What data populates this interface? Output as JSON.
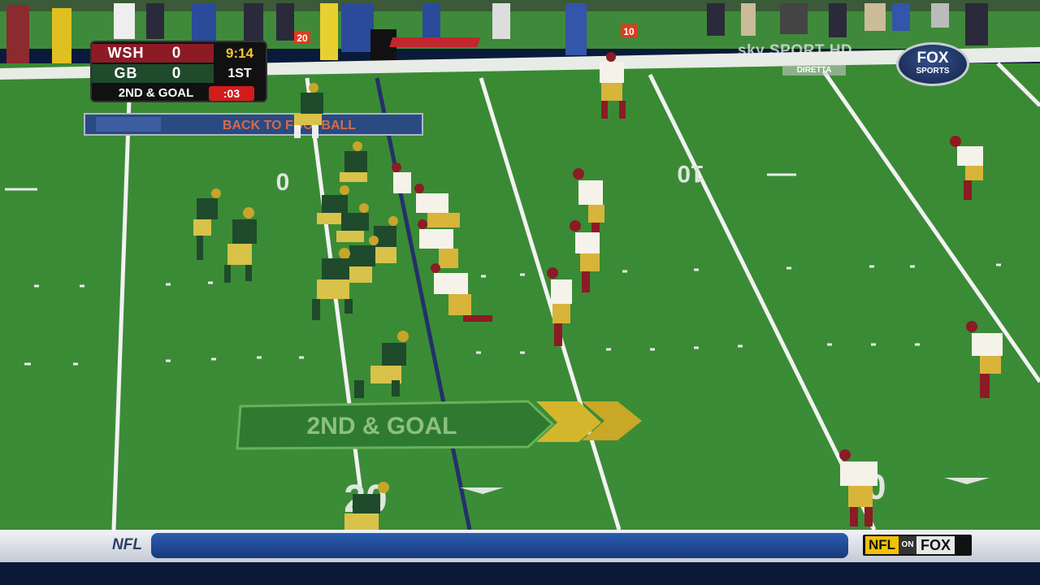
{
  "scoreboard": {
    "away_team": "WSH",
    "away_score": "0",
    "home_team": "GB",
    "home_score": "0",
    "game_clock": "9:14",
    "quarter": "1ST",
    "down_distance": "2ND & GOAL",
    "play_clock": ":03",
    "away_color": "#8c1b25",
    "home_color": "#1f4a2c"
  },
  "broadcast": {
    "sky_logo": "sky SPORT HD",
    "sky_sub": "DIRETTA",
    "fox_top": "FOX",
    "fox_bottom": "SPORTS"
  },
  "field": {
    "endzone_banner": "BACK TO FOOTBALL",
    "down_graphic": "2ND & GOAL",
    "yard_numbers": [
      "0",
      "10",
      "20",
      "10"
    ],
    "pylon_markers": [
      "20",
      "10"
    ],
    "field_color": "#3f8f38",
    "line_color": "#ffffff",
    "scrimmage_line_color": "#24306b"
  },
  "ticker": {
    "label": "NFL",
    "nfl": "NFL",
    "on": "ON",
    "fox": "FOX"
  },
  "players": {
    "packers_count": 11,
    "redskins_count": 11,
    "packers_jersey": "#1f4a2c",
    "redskins_jersey": "#f5f2ea"
  }
}
